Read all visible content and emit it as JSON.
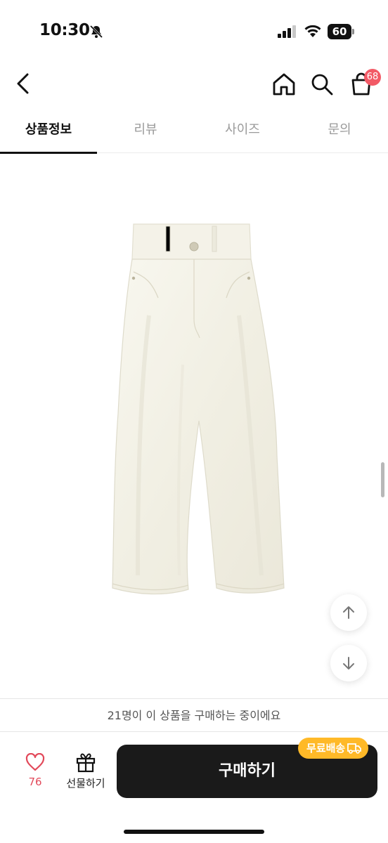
{
  "status_bar": {
    "time": "10:30",
    "battery": "60"
  },
  "header": {
    "cart_count": "68"
  },
  "tabs": [
    {
      "label": "상품정보",
      "active": true
    },
    {
      "label": "리뷰",
      "active": false
    },
    {
      "label": "사이즈",
      "active": false
    },
    {
      "label": "문의",
      "active": false
    }
  ],
  "notice": "21명이 이 상품을 구매하는 중이에요",
  "actions": {
    "like_count": "76",
    "gift_label": "선물하기",
    "buy_label": "구매하기",
    "free_shipping_label": "무료배송"
  },
  "colors": {
    "accent_badge": "#f25a66",
    "like": "#e2495a",
    "free_shipping": "#ffb928",
    "buy_button": "#1a1a1a"
  }
}
